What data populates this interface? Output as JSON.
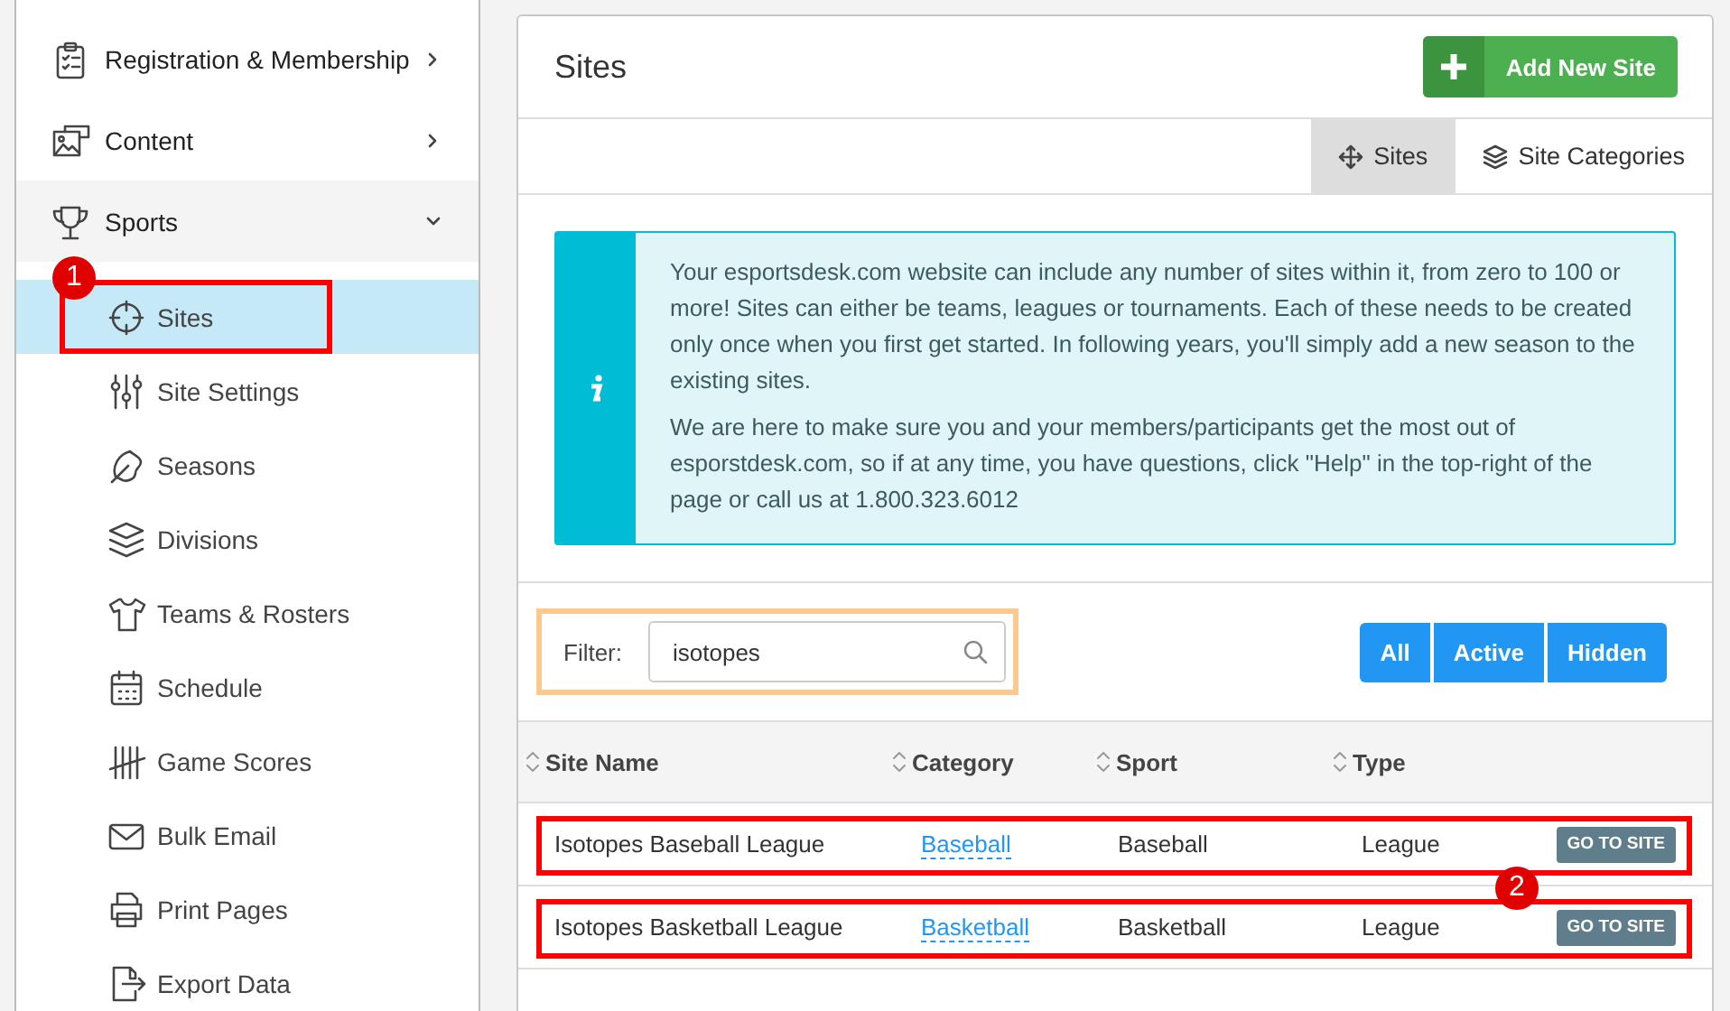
{
  "sidebar": {
    "items": [
      {
        "label": "Registration & Membership",
        "expanded": false
      },
      {
        "label": "Content",
        "expanded": false
      },
      {
        "label": "Sports",
        "expanded": true,
        "children": [
          {
            "label": "Sites",
            "selected": true,
            "highlighted": true,
            "badge": "1"
          },
          {
            "label": "Site Settings",
            "selected": false
          },
          {
            "label": "Seasons",
            "selected": false
          },
          {
            "label": "Divisions",
            "selected": false
          },
          {
            "label": "Teams & Rosters",
            "selected": false
          },
          {
            "label": "Schedule",
            "selected": false
          },
          {
            "label": "Game Scores",
            "selected": false
          },
          {
            "label": "Bulk Email",
            "selected": false
          },
          {
            "label": "Print Pages",
            "selected": false
          },
          {
            "label": "Export Data",
            "selected": false
          }
        ]
      }
    ]
  },
  "panel": {
    "title": "Sites",
    "add_button": "Add New Site",
    "tabs": [
      {
        "label": "Sites",
        "selected": true
      },
      {
        "label": "Site Categories",
        "selected": false
      }
    ],
    "info": [
      "Your esportsdesk.com website can include any number of sites within it, from zero to 100 or more! Sites can either be teams, leagues or tournaments. Each of these needs to be created only once when you first get started. In following years, you'll simply add a new season to the existing sites.",
      "We are here to make sure you and your members/participants get the most out of esporstdesk.com, so if at any time, you have questions, click \"Help\" in the top-right of the page or call us at 1.800.323.6012"
    ],
    "filter": {
      "label": "Filter:",
      "value": "isotopes",
      "highlighted": true
    },
    "filter_buttons": [
      "All",
      "Active",
      "Hidden"
    ],
    "table": {
      "columns": [
        "Site Name",
        "Category",
        "Sport",
        "Type"
      ],
      "rows": [
        {
          "site_name": "Isotopes Baseball League",
          "category": "Baseball",
          "sport": "Baseball",
          "type": "League",
          "action": "GO TO SITE",
          "highlighted": true,
          "badge": "2"
        },
        {
          "site_name": "Isotopes Basketball League",
          "category": "Basketball",
          "sport": "Basketball",
          "type": "League",
          "action": "GO TO SITE",
          "highlighted": true
        }
      ]
    }
  }
}
